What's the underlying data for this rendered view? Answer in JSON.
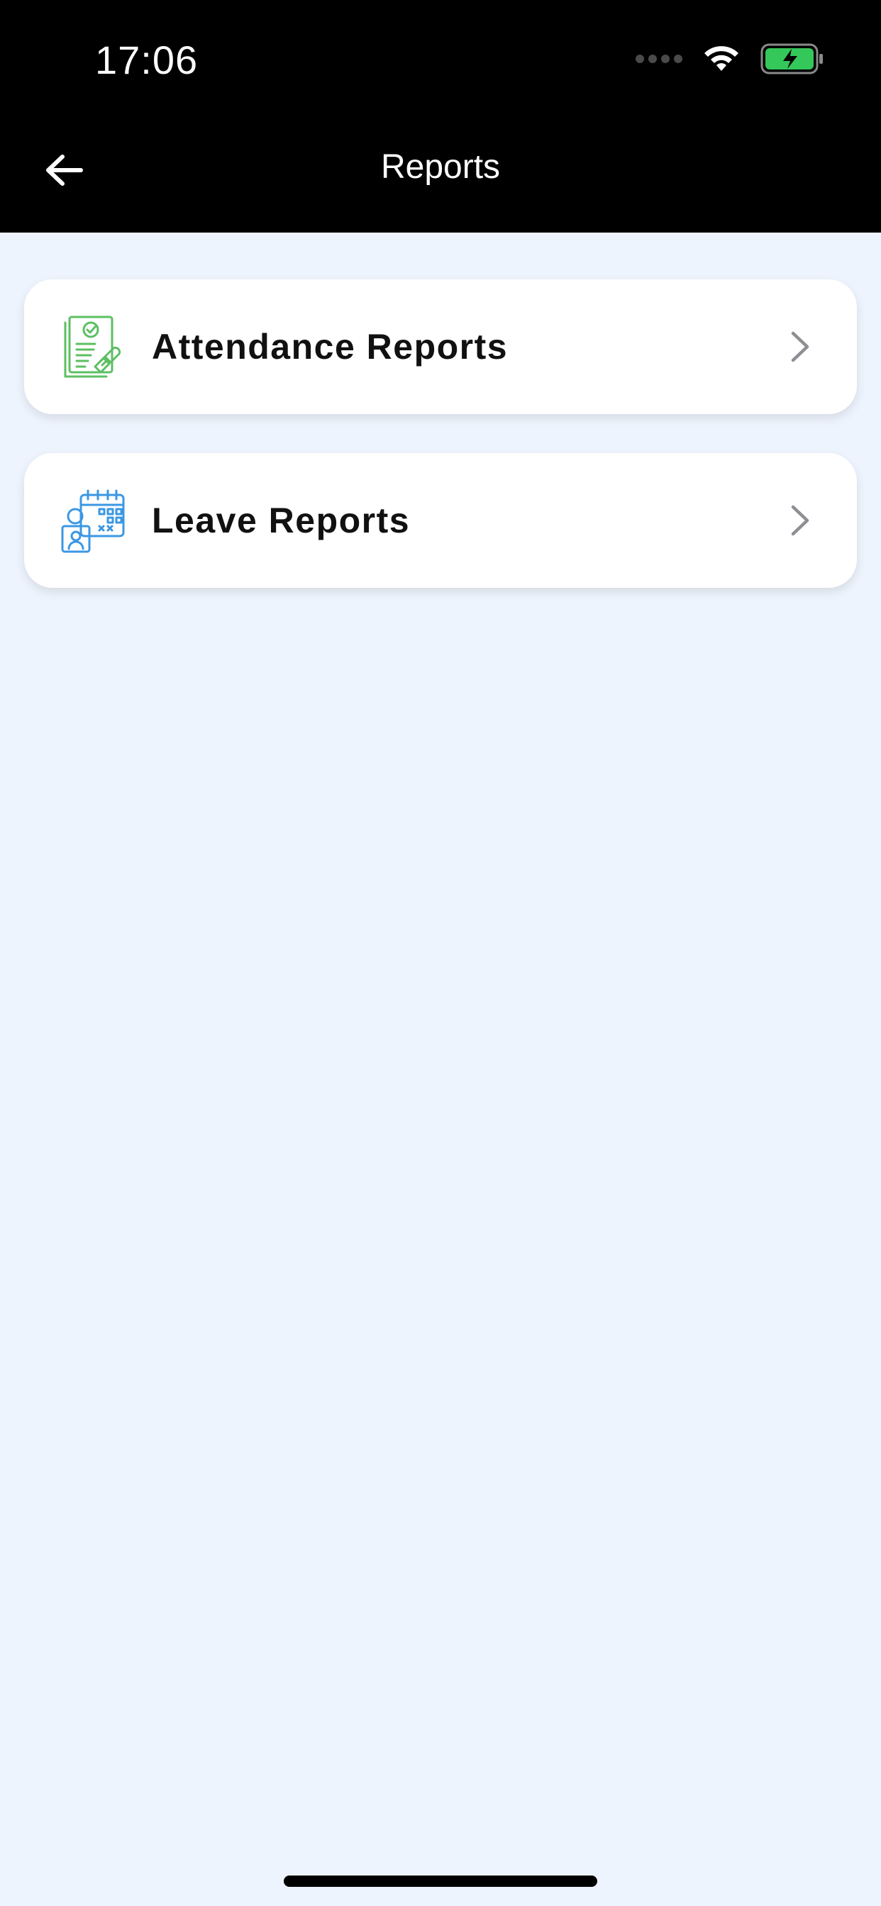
{
  "status_bar": {
    "time": "17:06",
    "battery_color": "#34C759",
    "icons": [
      "signal-dots-icon",
      "wifi-icon",
      "battery-charging-icon"
    ]
  },
  "header": {
    "title": "Reports",
    "back_icon": "arrow-left-icon"
  },
  "menu": {
    "items": [
      {
        "label": "Attendance Reports",
        "icon": "attendance-report-icon",
        "icon_color": "#5CBF62"
      },
      {
        "label": "Leave Reports",
        "icon": "leave-calendar-icon",
        "icon_color": "#3B97E3"
      }
    ],
    "chevron_icon": "chevron-right-icon"
  },
  "colors": {
    "header_bg": "#000000",
    "page_bg": "#EEF4FD",
    "card_bg": "#FFFFFF"
  }
}
